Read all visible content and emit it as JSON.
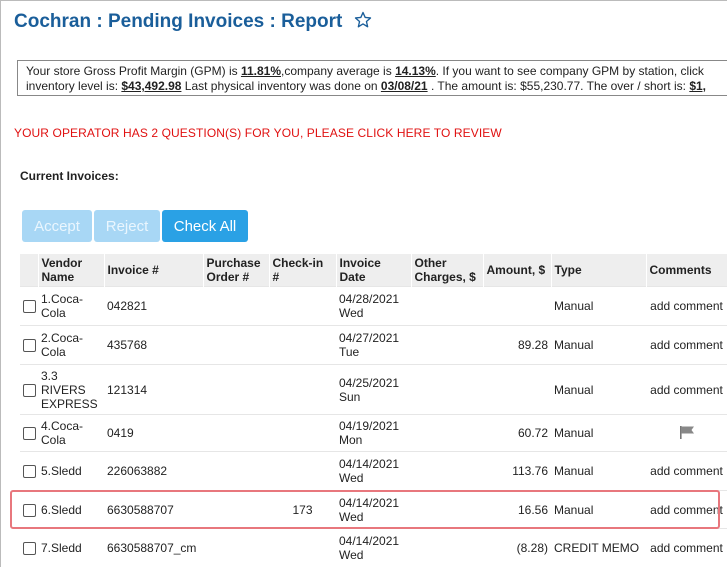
{
  "page": {
    "title": "Cochran : Pending Invoices : Report"
  },
  "gpm": {
    "line1_prefix": "Your store Gross Profit Margin (GPM) is ",
    "store_gpm": "11.81%",
    "line1_mid": ",company average is ",
    "company_gpm": "14.13%",
    "line1_suffix": ". If you want to see company GPM by station, click",
    "line2_prefix": "inventory level is: ",
    "inventory_level": "$43,492.98",
    "line2_mid": " Last physical inventory was done on ",
    "physical_date": "03/08/21",
    "line2_mid2": " . The amount is: $55,230.77. The over / short is: ",
    "over_short": "$1,"
  },
  "operator_message": "YOUR OPERATOR HAS 2 QUESTION(S) FOR YOU, PLEASE CLICK HERE TO REVIEW",
  "current_invoices_label": "Current Invoices:",
  "buttons": {
    "accept": "Accept",
    "reject": "Reject",
    "check_all": "Check All"
  },
  "table": {
    "headers": {
      "vendor_name": "Vendor Name",
      "invoice": "Invoice #",
      "purchase_order": "Purchase Order #",
      "checkin": "Check-in #",
      "invoice_date": "Invoice Date",
      "other_charges": "Other Charges, $",
      "amount": "Amount, $",
      "type": "Type",
      "comments": "Comments"
    },
    "rows": [
      {
        "vendor": "1.Coca-Cola",
        "invoice": "042821",
        "po": "",
        "checkin": "",
        "date": "04/28/2021",
        "day": "Wed",
        "other": "",
        "amount": "",
        "type": "Manual",
        "comment": "add comment"
      },
      {
        "vendor": "2.Coca-Cola",
        "invoice": "435768",
        "po": "",
        "checkin": "",
        "date": "04/27/2021",
        "day": "Tue",
        "other": "",
        "amount": "89.28",
        "type": "Manual",
        "comment": "add comment"
      },
      {
        "vendor": "3.3 RIVERS EXPRESS",
        "invoice": "121314",
        "po": "",
        "checkin": "",
        "date": "04/25/2021",
        "day": "Sun",
        "other": "",
        "amount": "",
        "type": "Manual",
        "comment": "add comment"
      },
      {
        "vendor": "4.Coca-Cola",
        "invoice": "0419",
        "po": "",
        "checkin": "",
        "date": "04/19/2021",
        "day": "Mon",
        "other": "",
        "amount": "60.72",
        "type": "Manual",
        "comment": ""
      },
      {
        "vendor": "5.Sledd",
        "invoice": "226063882",
        "po": "",
        "checkin": "",
        "date": "04/14/2021",
        "day": "Wed",
        "other": "",
        "amount": "113.76",
        "type": "Manual",
        "comment": "add comment"
      },
      {
        "vendor": "6.Sledd",
        "invoice": "6630588707",
        "po": "",
        "checkin": "173",
        "date": "04/14/2021",
        "day": "Wed",
        "other": "",
        "amount": "16.56",
        "type": "Manual",
        "comment": "add comment"
      },
      {
        "vendor": "7.Sledd",
        "invoice": "6630588707_cm",
        "po": "",
        "checkin": "",
        "date": "04/14/2021",
        "day": "Wed",
        "other": "",
        "amount": "(8.28)",
        "type": "CREDIT MEMO",
        "comment": "add comment"
      }
    ]
  },
  "colors": {
    "title": "#1a5e9a",
    "operator": "#e01010",
    "button_active": "#2aa1e5",
    "button_disabled": "#a8d7f5",
    "highlight": "#e8777d"
  },
  "icons": {
    "star": "star-outline-icon",
    "flag": "flag-icon"
  }
}
